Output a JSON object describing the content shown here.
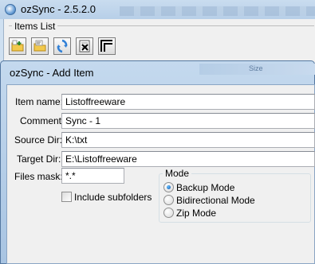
{
  "main_window": {
    "title": "ozSync - 2.5.2.0",
    "items_list_label": "Items List",
    "toolbar": [
      {
        "name": "add-item-button",
        "icon": "folder-add-icon"
      },
      {
        "name": "edit-item-button",
        "icon": "folder-edit-icon"
      },
      {
        "name": "sync-button",
        "icon": "sync-arrows-icon"
      },
      {
        "name": "delete-item-button",
        "icon": "delete-list-icon"
      },
      {
        "name": "window-button",
        "icon": "window-icon"
      }
    ]
  },
  "dialog": {
    "title": "ozSync - Add Item",
    "background_hint": "Size",
    "fields": {
      "item_name_label": "Item name:",
      "item_name_value": "Listoffreeware",
      "comment_label": "Comment:",
      "comment_value": "Sync - 1",
      "source_dir_label": "Source Dir:",
      "source_dir_value": "K:\\txt",
      "target_dir_label": "Target Dir:",
      "target_dir_value": "E:\\Listoffreeware",
      "files_mask_label": "Files mask:",
      "files_mask_value": "*.*"
    },
    "include_subfolders_label": "Include subfolders",
    "include_subfolders_checked": false,
    "mode": {
      "legend": "Mode",
      "options": [
        "Backup Mode",
        "Bidirectional Mode",
        "Zip Mode"
      ],
      "selected": "Backup Mode"
    }
  },
  "colors": {
    "titlebar": "#b7cfe8",
    "client_bg": "#f0f0f0",
    "border": "#5477a0"
  }
}
